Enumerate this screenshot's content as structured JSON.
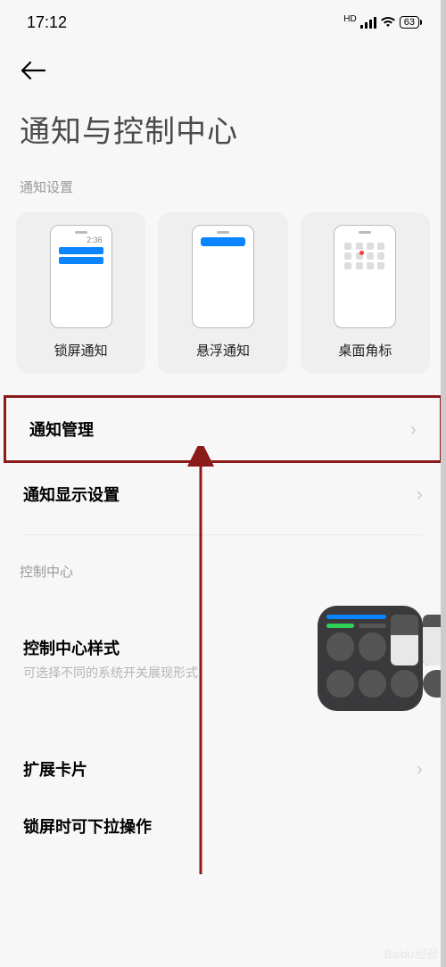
{
  "status": {
    "time": "17:12",
    "hd": "HD",
    "battery": "63"
  },
  "page": {
    "title": "通知与控制中心"
  },
  "sections": {
    "notif_label": "通知设置",
    "cc_label": "控制中心"
  },
  "cards": {
    "lock": {
      "label": "锁屏通知",
      "mini_time": "2:36"
    },
    "float": {
      "label": "悬浮通知"
    },
    "badge": {
      "label": "桌面角标"
    }
  },
  "items": {
    "manage": {
      "title": "通知管理"
    },
    "display": {
      "title": "通知显示设置"
    },
    "cc_style": {
      "title": "控制中心样式",
      "sub": "可选择不同的系统开关展现形式"
    },
    "ext_cards": {
      "title": "扩展卡片"
    },
    "lock_pull": {
      "title": "锁屏时可下拉操作"
    }
  },
  "watermark": "Baidu经验"
}
